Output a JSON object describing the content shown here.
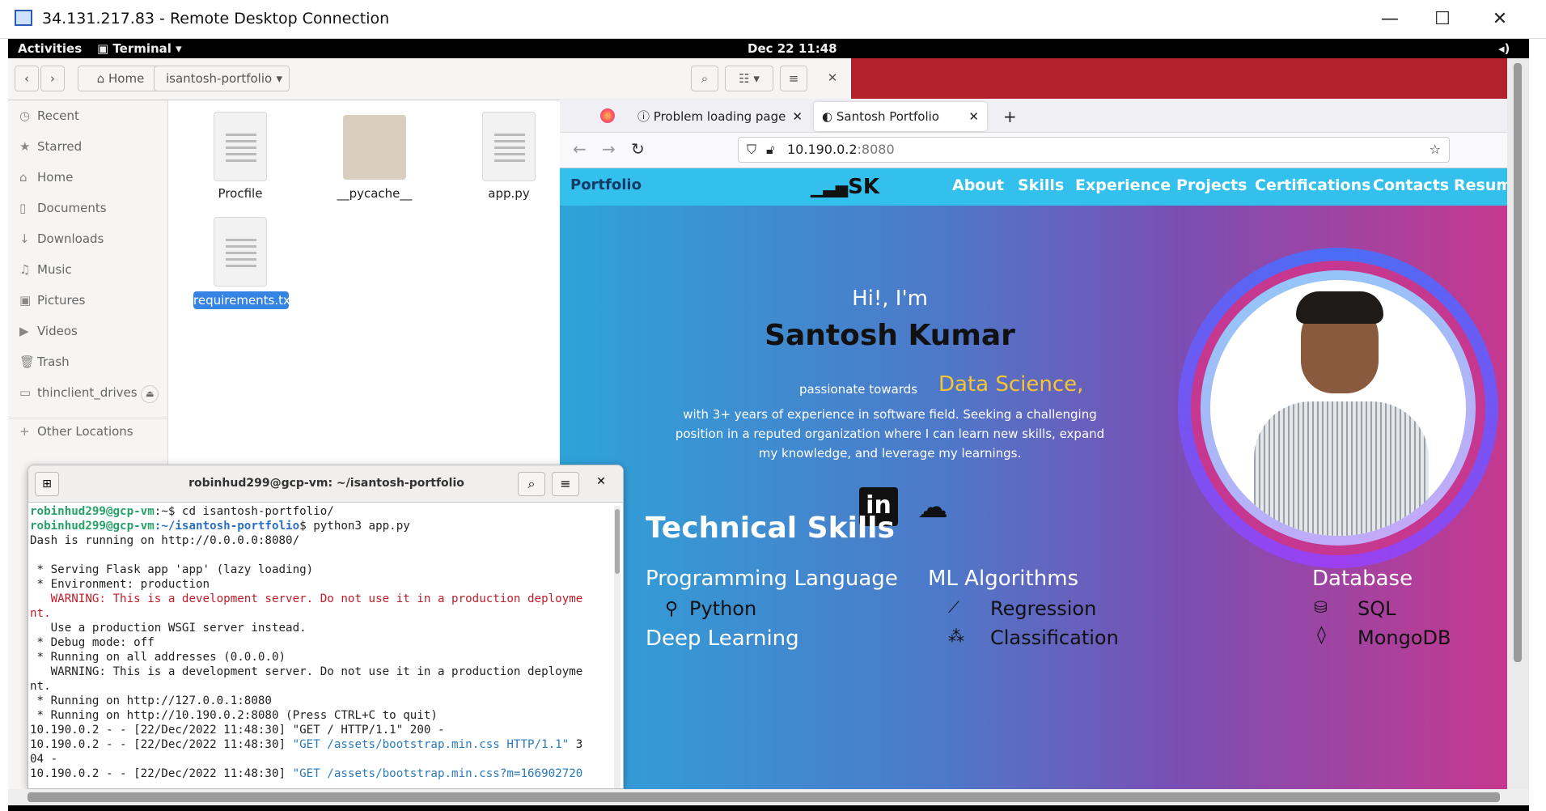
{
  "rdp": {
    "title": "34.131.217.83 - Remote Desktop Connection",
    "min": "—",
    "max": "☐",
    "close": "✕"
  },
  "topbar": {
    "activities": "Activities",
    "app": "Terminal ▾",
    "clock": "Dec 22  11:48"
  },
  "files": {
    "path_home": "Home",
    "path_folder": "isantosh-portfolio",
    "sidebar": [
      {
        "icon": "◷",
        "label": "Recent"
      },
      {
        "icon": "★",
        "label": "Starred"
      },
      {
        "icon": "⌂",
        "label": "Home"
      },
      {
        "icon": "▯",
        "label": "Documents"
      },
      {
        "icon": "↓",
        "label": "Downloads"
      },
      {
        "icon": "♫",
        "label": "Music"
      },
      {
        "icon": "▣",
        "label": "Pictures"
      },
      {
        "icon": "▶",
        "label": "Videos"
      },
      {
        "icon": "🗑",
        "label": "Trash"
      },
      {
        "icon": "▭",
        "label": "thinclient_drives"
      },
      {
        "icon": "+",
        "label": "Other Locations"
      }
    ],
    "items": [
      "Procfile",
      "__pycache__",
      "app.py",
      "requirements.txt"
    ]
  },
  "browser": {
    "tab1": "Problem loading page",
    "tab2": "Santosh Portfolio",
    "url_host": "10.190.0.2",
    "url_port": ":8080",
    "nav": {
      "brand": "Portfolio",
      "logo": "SK",
      "items": [
        "About",
        "Skills",
        "Experience",
        "Projects",
        "Certifications",
        "Contacts",
        "Resum"
      ]
    },
    "hero": {
      "greeting": "Hi!, I'm",
      "name": "Santosh Kumar",
      "passion": "passionate towards",
      "field": "Data Science,",
      "bio1": "with 3+ years of experience in software field. Seeking a challenging",
      "bio2": "position in a reputed organization where I can learn new skills, expand",
      "bio3": "my knowledge, and leverage my learnings."
    },
    "skills": {
      "heading": "Technical Skills",
      "col1": "Programming Language",
      "col1_item": "Python",
      "col1b": "Deep Learning",
      "col2": "ML Algorithms",
      "col2_item1": "Regression",
      "col2_item2": "Classification",
      "col3": "Database",
      "col3_item1": "SQL",
      "col3_item2": "MongoDB"
    }
  },
  "terminal": {
    "title": "robinhud299@gcp-vm: ~/isantosh-portfolio",
    "prompt_user": "robinhud299@gcp-vm",
    "prompt_home": ":~$ ",
    "cmd1": "cd isantosh-portfolio/",
    "prompt_path": ":~/isantosh-portfolio",
    "cmd2": "$ python3 app.py",
    "l3": "Dash is running on http://0.0.0.0:8080/",
    "l5": " * Serving Flask app 'app' (lazy loading)",
    "l6": " * Environment: production",
    "l7": "   WARNING: This is a development server. Do not use it in a production deployme",
    "l8": "nt.",
    "l9": "   Use a production WSGI server instead.",
    "l10": " * Debug mode: off",
    "l11": " * Running on all addresses (0.0.0.0)",
    "l12": "   WARNING: This is a development server. Do not use it in a production deployme",
    "l13": "nt.",
    "l14": " * Running on http://127.0.0.1:8080",
    "l15": " * Running on http://10.190.0.2:8080 (Press CTRL+C to quit)",
    "l16a": "10.190.0.2 - - [22/Dec/2022 11:48:30] \"GET / HTTP/1.1\" 200 -",
    "l17a": "10.190.0.2 - - [22/Dec/2022 11:48:30] ",
    "l17b": "\"GET /assets/bootstrap.min.css HTTP/1.1\"",
    "l17c": " 3",
    "l18": "04 -",
    "l19a": "10.190.0.2 - - [22/Dec/2022 11:48:30] ",
    "l19b": "\"GET /assets/bootstrap.min.css?m=166902720"
  }
}
